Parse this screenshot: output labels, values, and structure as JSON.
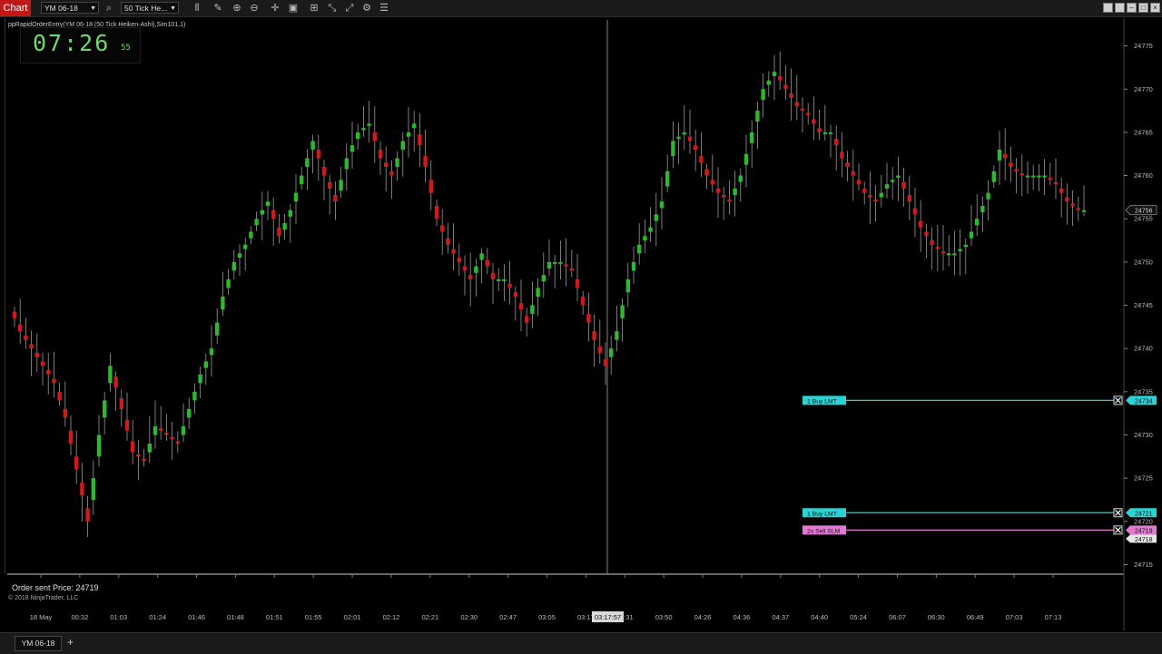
{
  "toolbar": {
    "chart_tab": "Chart",
    "instrument": "YM 06-18",
    "bar_type": "50 Tick He...",
    "icons": [
      "search-icon",
      "bars-icon",
      "pencil-icon",
      "zoom-in-icon",
      "zoom-out-icon",
      "crosshair-icon",
      "data-box-icon",
      "strategy-icon",
      "arrange-icon",
      "properties-icon",
      "list-icon"
    ]
  },
  "window_controls": [
    "restore-icon",
    "minimize-icon",
    "maximize-icon",
    "close-icon"
  ],
  "indicator_label": "ppRapidOrderEntry(YM 06-18 (50 Tick Heiken-Ashi),Sim101,1)",
  "clock": {
    "time": "07:26",
    "seconds": "55"
  },
  "status": {
    "order_sent": "Order sent Price: 24719",
    "copyright": "© 2018 NinjaTrader, LLC"
  },
  "chart_data": {
    "type": "candlestick",
    "instrument": "YM 06-18",
    "ylim": [
      24714,
      24778
    ],
    "y_ticks": [
      24715,
      24720,
      24725,
      24730,
      24735,
      24740,
      24745,
      24750,
      24755,
      24760,
      24765,
      24770,
      24775
    ],
    "x_tick_labels": [
      "18 May",
      "00:32",
      "01:03",
      "01:24",
      "01:46",
      "01:48",
      "01:51",
      "01:55",
      "02:01",
      "02:12",
      "02:21",
      "02:30",
      "02:47",
      "03:05",
      "03:17",
      "03:31",
      "03:50",
      "04:26",
      "04:36",
      "04:37",
      "04:40",
      "05:24",
      "06:07",
      "06:30",
      "06:49",
      "07:03",
      "07:13"
    ],
    "crosshair": {
      "time_label": "03:17:57"
    },
    "last_price": "24756",
    "price_path": [
      24745,
      24742,
      24740,
      24738,
      24736,
      24732,
      24726,
      24720,
      24730,
      24738,
      24733,
      24728,
      24727,
      24731,
      24730,
      24729,
      24733,
      24737,
      24740,
      24746,
      24750,
      24752,
      24755,
      24757,
      24753,
      24756,
      24760,
      24764,
      24760,
      24757,
      24762,
      24765,
      24766,
      24762,
      24760,
      24764,
      24766,
      24761,
      24755,
      24752,
      24750,
      24748,
      24751,
      24748,
      24748,
      24746,
      24743,
      24747,
      24750,
      24750,
      24749,
      24745,
      24741,
      24738,
      24742,
      24748,
      24752,
      24754,
      24757,
      24764,
      24765,
      24763,
      24760,
      24758,
      24757,
      24760,
      24765,
      24770,
      24772,
      24770,
      24768,
      24767,
      24765,
      24765,
      24762,
      24760,
      24758,
      24757,
      24759,
      24760,
      24757,
      24754,
      24752,
      24751,
      24751,
      24752,
      24755,
      24758,
      24763,
      24761,
      24760,
      24760,
      24760,
      24759,
      24757,
      24756
    ],
    "orders": [
      {
        "label": "1  Buy LMT",
        "price": 24734,
        "price_label": "24734",
        "color": "#2ad4d4",
        "kind": "buy"
      },
      {
        "label": "1  Buy LMT",
        "price": 24721,
        "price_label": "24721",
        "color": "#2ad4d4",
        "kind": "buy"
      },
      {
        "label": "2s  Sell SLM",
        "price": 24719,
        "price_label": "24719",
        "color": "#e07ad0",
        "kind": "sell"
      }
    ],
    "bid_ask_marker": "24718",
    "up_color": "#2db92d",
    "down_color": "#d01a1a"
  },
  "bottom": {
    "instrument_tab": "YM 06-18",
    "add_tab": "+"
  }
}
